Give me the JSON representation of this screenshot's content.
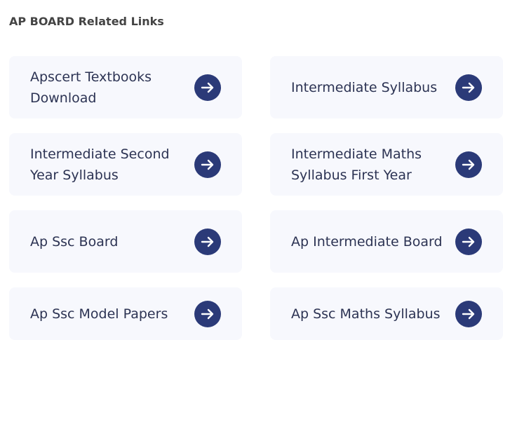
{
  "section": {
    "title": "AP BOARD Related Links"
  },
  "links": [
    {
      "label": "Apscert Textbooks Download"
    },
    {
      "label": "Intermediate Syllabus"
    },
    {
      "label": "Intermediate Second Year Syllabus"
    },
    {
      "label": "Intermediate Maths Syllabus First Year"
    },
    {
      "label": "Ap Ssc Board"
    },
    {
      "label": "Ap Intermediate Board"
    },
    {
      "label": "Ap Ssc Model Papers"
    },
    {
      "label": "Ap Ssc Maths Syllabus"
    }
  ],
  "icons": {
    "arrow": "arrow-right-icon"
  },
  "colors": {
    "card_background": "#f7f8fd",
    "button": "#2b3a78",
    "text": "#2c3353",
    "title": "#444444"
  }
}
